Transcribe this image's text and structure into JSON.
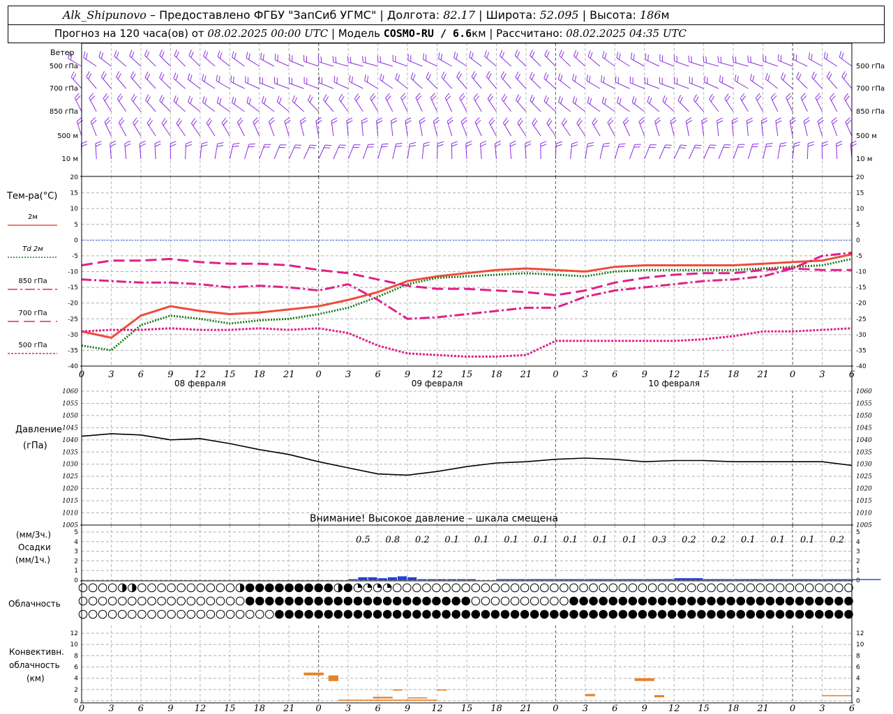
{
  "header": {
    "station": "Alk_Shipunovo",
    "provider": " – Предоставлено ФГБУ \"ЗапСиб УГМС\" | Долгота: ",
    "lon": "82.17",
    "lat_label": " | Широта: ",
    "lat": "52.095",
    "alt_label": " | Высота: ",
    "alt": "186",
    "alt_unit": "м",
    "forecast_prefix": "Прогноз на 120 часа(ов) от ",
    "forecast_start": "08.02.2025 00:00 UTC",
    "model_prefix": " | Модель ",
    "model": "COSMO-RU / 6.6",
    "model_unit": "км",
    "calc_prefix": " | Рассчитано: ",
    "calc_time": "08.02.2025 04:35 UTC"
  },
  "wind_panel": {
    "title": "Ветер",
    "levels": [
      "500 гПа",
      "700 гПа",
      "850 гПа",
      "500 м",
      "10   м"
    ],
    "color": "#8a2be2"
  },
  "temp_panel": {
    "title": "Тем-ра(°C)",
    "legend": [
      {
        "label": "2м",
        "color": "#ee4b3a",
        "dash": "solid"
      },
      {
        "label": "Td  2м",
        "color": "#1b7a1b",
        "dash": "dot"
      },
      {
        "label": "850 гПа",
        "color": "#e0208a",
        "dash": "dashdot"
      },
      {
        "label": "700 гПа",
        "color": "#e0208a",
        "dash": "dash"
      },
      {
        "label": "500 гПа",
        "color": "#e0208a",
        "dash": "fine"
      }
    ],
    "y_ticks": [
      "20",
      "15",
      "10",
      "5",
      "0",
      "-5",
      "-10",
      "-15",
      "-20",
      "-25",
      "-30",
      "-35",
      "-40"
    ]
  },
  "time_axis": {
    "hours": [
      "0",
      "3",
      "6",
      "9",
      "12",
      "15",
      "18",
      "21",
      "0",
      "3",
      "6",
      "9",
      "12",
      "15",
      "18",
      "21",
      "0",
      "3",
      "6",
      "9",
      "12",
      "15",
      "18",
      "21",
      "0",
      "3",
      "6"
    ],
    "dates": [
      "08 февраля",
      "09 февраля",
      "10 февраля"
    ]
  },
  "pressure_panel": {
    "title": "Давление",
    "unit": "(гПа)",
    "y_ticks": [
      "1060",
      "1055",
      "1050",
      "1045",
      "1040",
      "1035",
      "1030",
      "1025",
      "1020",
      "1015",
      "1010",
      "1005"
    ],
    "warning": "Внимание! Высокое давление – шкала смещена"
  },
  "precip_panel": {
    "unit3": "(мм/3ч.)",
    "title": "Осадки",
    "unit1": "(мм/1ч.)",
    "y_ticks": [
      "5",
      "4",
      "3",
      "2",
      "1",
      "0"
    ],
    "totals": [
      "0.5",
      "0.8",
      "0.2",
      "0.1",
      "0.1",
      "0.1",
      "0.1",
      "0.1",
      "0.1",
      "0.1",
      "0.3",
      "0.2",
      "0.2",
      "0.1",
      "0.1",
      "0.1",
      "0.2"
    ],
    "color": "#2040e0"
  },
  "cloud_panel": {
    "title": "Облачность"
  },
  "conv_panel": {
    "title1": "Конвективн.",
    "title2": "облачность",
    "unit": "(км)",
    "y_ticks": [
      "12",
      "10",
      "8",
      "6",
      "4",
      "2",
      "0"
    ],
    "color": "#e8822a"
  },
  "chart_data": [
    {
      "type": "line",
      "title": "Тем-ра(°C)",
      "x_hours": [
        0,
        3,
        6,
        9,
        12,
        15,
        18,
        21,
        24,
        27,
        30,
        33,
        36,
        39,
        42,
        45,
        48,
        51,
        54,
        57,
        60,
        63,
        66,
        69,
        72,
        75,
        78
      ],
      "ylim": [
        -40,
        20
      ],
      "series": [
        {
          "name": "2м",
          "values": [
            -29,
            -31,
            -24,
            -21,
            -22.5,
            -23.5,
            -23,
            -22,
            -21,
            -19,
            -16.5,
            -13,
            -11.5,
            -10.5,
            -9.5,
            -9,
            -9.5,
            -10,
            -8.5,
            -8,
            -8,
            -8,
            -8,
            -7.5,
            -7,
            -6.5,
            -4.5
          ]
        },
        {
          "name": "Td  2м",
          "values": [
            -33.5,
            -35,
            -27,
            -24,
            -25,
            -26.5,
            -25.5,
            -25,
            -23.5,
            -21.5,
            -18,
            -14,
            -12,
            -11.5,
            -11,
            -10.5,
            -11,
            -11.5,
            -10,
            -9.5,
            -9.5,
            -9.5,
            -9.5,
            -9,
            -8.5,
            -8,
            -6
          ]
        },
        {
          "name": "850 гПа",
          "values": [
            -12.5,
            -13,
            -13.5,
            -13.5,
            -14,
            -15,
            -14.5,
            -15,
            -16,
            -14,
            -19,
            -25,
            -24.5,
            -23.5,
            -22.5,
            -21.5,
            -21.5,
            -18,
            -16,
            -15,
            -14,
            -13,
            -12.5,
            -11.5,
            -9,
            -5,
            -4
          ]
        },
        {
          "name": "700 гПа",
          "values": [
            -8,
            -6.5,
            -6.5,
            -6,
            -7,
            -7.5,
            -7.5,
            -8,
            -9.5,
            -10.5,
            -12.5,
            -14.5,
            -15.5,
            -15.5,
            -16,
            -16.5,
            -17.5,
            -16,
            -13.5,
            -12,
            -11,
            -10.5,
            -10.5,
            -9.5,
            -9,
            -9.5,
            -9.5
          ]
        },
        {
          "name": "500 гПа",
          "values": [
            -29,
            -28.5,
            -28.5,
            -28,
            -28.5,
            -28.5,
            -28,
            -28.5,
            -28,
            -29.5,
            -33.5,
            -36,
            -36.5,
            -37,
            -37,
            -36.5,
            -32,
            -32,
            -32,
            -32,
            -32,
            -31.5,
            -30.5,
            -29,
            -29,
            -28.5,
            -28
          ]
        }
      ]
    },
    {
      "type": "line",
      "title": "Давление",
      "x_hours": [
        0,
        3,
        6,
        9,
        12,
        15,
        18,
        21,
        24,
        27,
        30,
        33,
        36,
        39,
        42,
        45,
        48,
        51,
        54,
        57,
        60,
        63,
        66,
        69,
        72,
        75,
        78
      ],
      "ylim": [
        1005,
        1060
      ],
      "series": [
        {
          "name": "Давление",
          "values": [
            1041.5,
            1042.5,
            1042,
            1040,
            1040.5,
            1038.5,
            1036,
            1034,
            1031,
            1028.5,
            1026,
            1025.5,
            1027,
            1029,
            1030.5,
            1031,
            1032,
            1032.5,
            1032,
            1031,
            1031.5,
            1031.5,
            1031,
            1031,
            1031,
            1031,
            1029.5
          ]
        }
      ]
    },
    {
      "type": "bar",
      "title": "Осадки",
      "x_hours": [
        27,
        28,
        29,
        30,
        31,
        32,
        33,
        34,
        35,
        36,
        37,
        38,
        39,
        42,
        45,
        48,
        51,
        54,
        57,
        60,
        63,
        66,
        69,
        72,
        75,
        78
      ],
      "ylim": [
        0,
        5
      ],
      "series": [
        {
          "name": "Осадки",
          "values": [
            0.1,
            0.3,
            0.3,
            0.2,
            0.3,
            0.4,
            0.3,
            0.1,
            0.1,
            0.1,
            0.1,
            0.1,
            0.1,
            0.1,
            0.1,
            0.1,
            0.1,
            0.1,
            0.1,
            0.2,
            0.1,
            0.1,
            0.1,
            0.1,
            0.1,
            0.1
          ]
        }
      ]
    },
    {
      "type": "bar",
      "title": "Конвективн. облачность",
      "segments": [
        {
          "x0": 22.5,
          "x1": 24.5,
          "y0": 4.5,
          "y1": 5
        },
        {
          "x0": 25,
          "x1": 26,
          "y0": 3.5,
          "y1": 4.5
        },
        {
          "x0": 26,
          "x1": 36,
          "y0": 0,
          "y1": 0.2
        },
        {
          "x0": 29.5,
          "x1": 31.5,
          "y0": 0.4,
          "y1": 0.7
        },
        {
          "x0": 31.5,
          "x1": 32.5,
          "y0": 1.8,
          "y1": 2
        },
        {
          "x0": 33,
          "x1": 35,
          "y0": 0.4,
          "y1": 0.6
        },
        {
          "x0": 36,
          "x1": 37,
          "y0": 1.8,
          "y1": 2
        },
        {
          "x0": 51,
          "x1": 52,
          "y0": 0.8,
          "y1": 1.2
        },
        {
          "x0": 56,
          "x1": 58,
          "y0": 3.5,
          "y1": 4
        },
        {
          "x0": 58,
          "x1": 59,
          "y0": 0.6,
          "y1": 1
        },
        {
          "x0": 75,
          "x1": 78,
          "y0": 0.8,
          "y1": 1
        }
      ],
      "ylim": [
        0,
        13
      ]
    }
  ]
}
